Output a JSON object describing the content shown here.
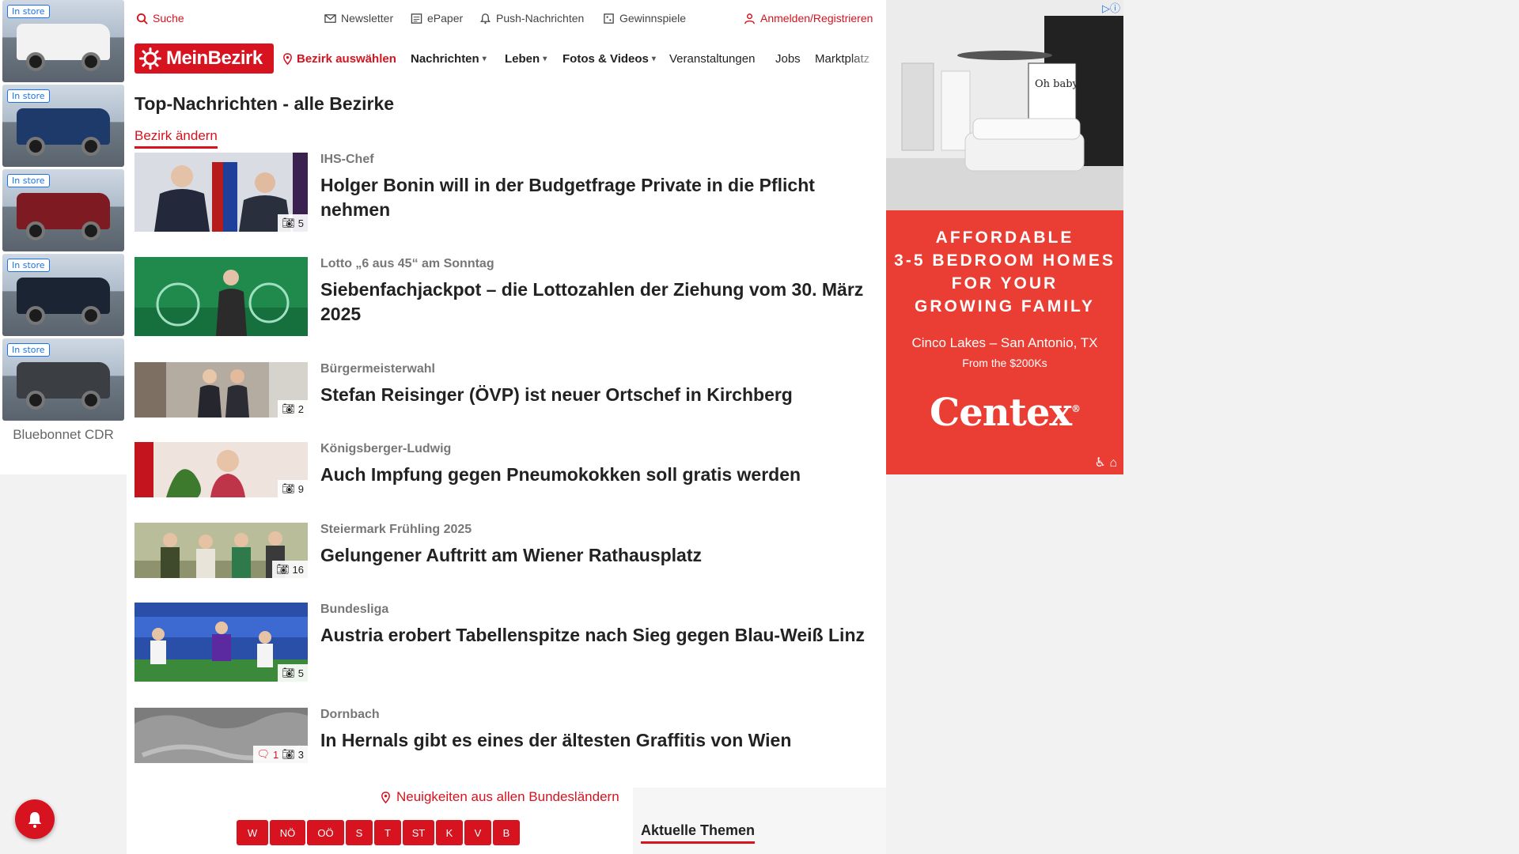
{
  "left_ad": {
    "tiles": [
      {
        "label": "In store"
      },
      {
        "label": "In store"
      },
      {
        "label": "In store"
      },
      {
        "label": "In store"
      },
      {
        "label": "In store"
      }
    ],
    "brand": "Bluebonnet CDR",
    "truck_colors": [
      "#f2f2f2",
      "#1d3a6b",
      "#7e1b22",
      "#1b2433",
      "#3b3f44"
    ]
  },
  "utility": {
    "search": "Suche",
    "newsletter": "Newsletter",
    "epaper": "ePaper",
    "push": "Push-Nachrichten",
    "games": "Gewinnspiele",
    "login": "Anmelden/Registrieren"
  },
  "nav": {
    "logo": "MeinBezirk",
    "district": "Bezirk auswählen",
    "items": [
      "Nachrichten",
      "Leben",
      "Fotos & Videos",
      "Veranstaltungen",
      "Jobs",
      "Marktplatz"
    ]
  },
  "section": {
    "title": "Top-Nachrichten - alle Bezirke",
    "change_link": "Bezirk ändern"
  },
  "articles": [
    {
      "kicker": "IHS-Chef",
      "headline": "Holger Bonin will in der Budgetfrage Private in die Pflicht nehmen",
      "photos": "5",
      "comments": ""
    },
    {
      "kicker": "Lotto „6 aus 45“ am Sonntag",
      "headline": "Siebenfachjackpot – die Lottozahlen der Ziehung vom 30. März 2025",
      "photos": "",
      "comments": ""
    },
    {
      "kicker": "Bürgermeisterwahl",
      "headline": "Stefan Reisinger (ÖVP) ist neuer Ortschef in Kirchberg",
      "photos": "2",
      "comments": ""
    },
    {
      "kicker": "Königsberger-Ludwig",
      "headline": "Auch Impfung gegen Pneumokokken soll gratis werden",
      "photos": "9",
      "comments": ""
    },
    {
      "kicker": "Steiermark Frühling 2025",
      "headline": "Gelungener Auftritt am Wiener Rathausplatz",
      "photos": "16",
      "comments": ""
    },
    {
      "kicker": "Bundesliga",
      "headline": "Austria erobert Tabellenspitze nach Sieg gegen Blau-Weiß Linz",
      "photos": "5",
      "comments": ""
    },
    {
      "kicker": "Dornbach",
      "headline": "In Hernals gibt es eines der ältesten Graffitis von Wien",
      "photos": "3",
      "comments": "1"
    }
  ],
  "thumb_colors": [
    "#c9ced6",
    "#1f8a4c",
    "#9a9187",
    "#e8d9d4",
    "#9aa07c",
    "#2a4fa8",
    "#9a9a9a"
  ],
  "regions_link": "Neuigkeiten aus allen Bundesländern",
  "regions": [
    "W",
    "NÖ",
    "OÖ",
    "S",
    "T",
    "ST",
    "K",
    "V",
    "B"
  ],
  "topics_title": "Aktuelle Themen",
  "right_ad": {
    "headline_lines": [
      "AFFORDABLE",
      "3-5 BEDROOM HOMES",
      "FOR YOUR",
      "GROWING FAMILY"
    ],
    "location": "Cinco Lakes – San Antonio, TX",
    "price": "From the $200Ks",
    "brand": "Centex",
    "brand_mark": "®",
    "art_text": "Oh baby"
  },
  "colors": {
    "accent": "#d6131f",
    "ad_red": "#ea3d33"
  }
}
